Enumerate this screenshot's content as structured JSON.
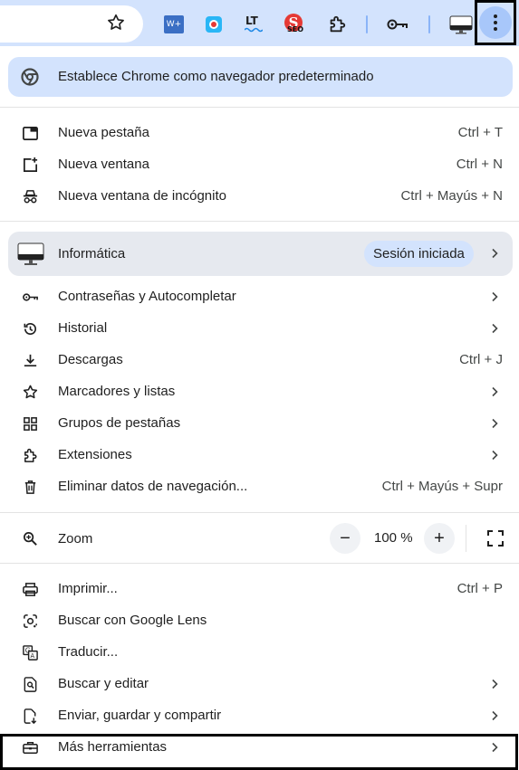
{
  "toolbar": {
    "bookmark_icon": "star-outline-icon",
    "extensions": [
      {
        "name": "word-plus-extension-icon",
        "text": "W+"
      },
      {
        "name": "color-picker-extension-icon",
        "text": ""
      },
      {
        "name": "languagetool-extension-icon",
        "text": "LT"
      },
      {
        "name": "seo-extension-icon",
        "text": "SEO"
      },
      {
        "name": "extensions-puzzle-icon",
        "text": ""
      },
      {
        "name": "password-key-icon",
        "text": ""
      },
      {
        "name": "profile-avatar-icon",
        "text": ""
      }
    ],
    "menu_icon": "three-dots-vertical-icon"
  },
  "menu": {
    "banner": {
      "icon": "chrome-logo-icon",
      "label": "Establece Chrome como navegador predeterminado"
    },
    "group1": [
      {
        "icon": "new-tab-icon",
        "label": "Nueva pestaña",
        "shortcut": "Ctrl + T"
      },
      {
        "icon": "new-window-icon",
        "label": "Nueva ventana",
        "shortcut": "Ctrl + N"
      },
      {
        "icon": "incognito-icon",
        "label": "Nueva ventana de incógnito",
        "shortcut": "Ctrl + Mayús + N"
      }
    ],
    "profile": {
      "name": "Informática",
      "status": "Sesión iniciada"
    },
    "group2": [
      {
        "icon": "key-icon",
        "label": "Contraseñas y Autocompletar",
        "shortcut": ""
      },
      {
        "icon": "history-icon",
        "label": "Historial",
        "shortcut": ""
      },
      {
        "icon": "download-icon",
        "label": "Descargas",
        "shortcut": "Ctrl + J"
      },
      {
        "icon": "star-icon",
        "label": "Marcadores y listas",
        "shortcut": ""
      },
      {
        "icon": "tab-groups-icon",
        "label": "Grupos de pestañas",
        "shortcut": ""
      },
      {
        "icon": "puzzle-icon",
        "label": "Extensiones",
        "shortcut": ""
      },
      {
        "icon": "trash-icon",
        "label": "Eliminar datos de navegación...",
        "shortcut": "Ctrl + Mayús + Supr"
      }
    ],
    "zoom": {
      "label": "Zoom",
      "value": "100 %",
      "minus": "−",
      "plus": "+"
    },
    "group3": [
      {
        "icon": "print-icon",
        "label": "Imprimir...",
        "shortcut": "Ctrl + P"
      },
      {
        "icon": "google-lens-icon",
        "label": "Buscar con Google Lens",
        "shortcut": ""
      },
      {
        "icon": "translate-icon",
        "label": "Traducir...",
        "shortcut": ""
      },
      {
        "icon": "find-edit-icon",
        "label": "Buscar y editar",
        "shortcut": ""
      },
      {
        "icon": "send-save-share-icon",
        "label": "Enviar, guardar y compartir",
        "shortcut": ""
      },
      {
        "icon": "toolbox-icon",
        "label": "Más herramientas",
        "shortcut": ""
      }
    ]
  }
}
